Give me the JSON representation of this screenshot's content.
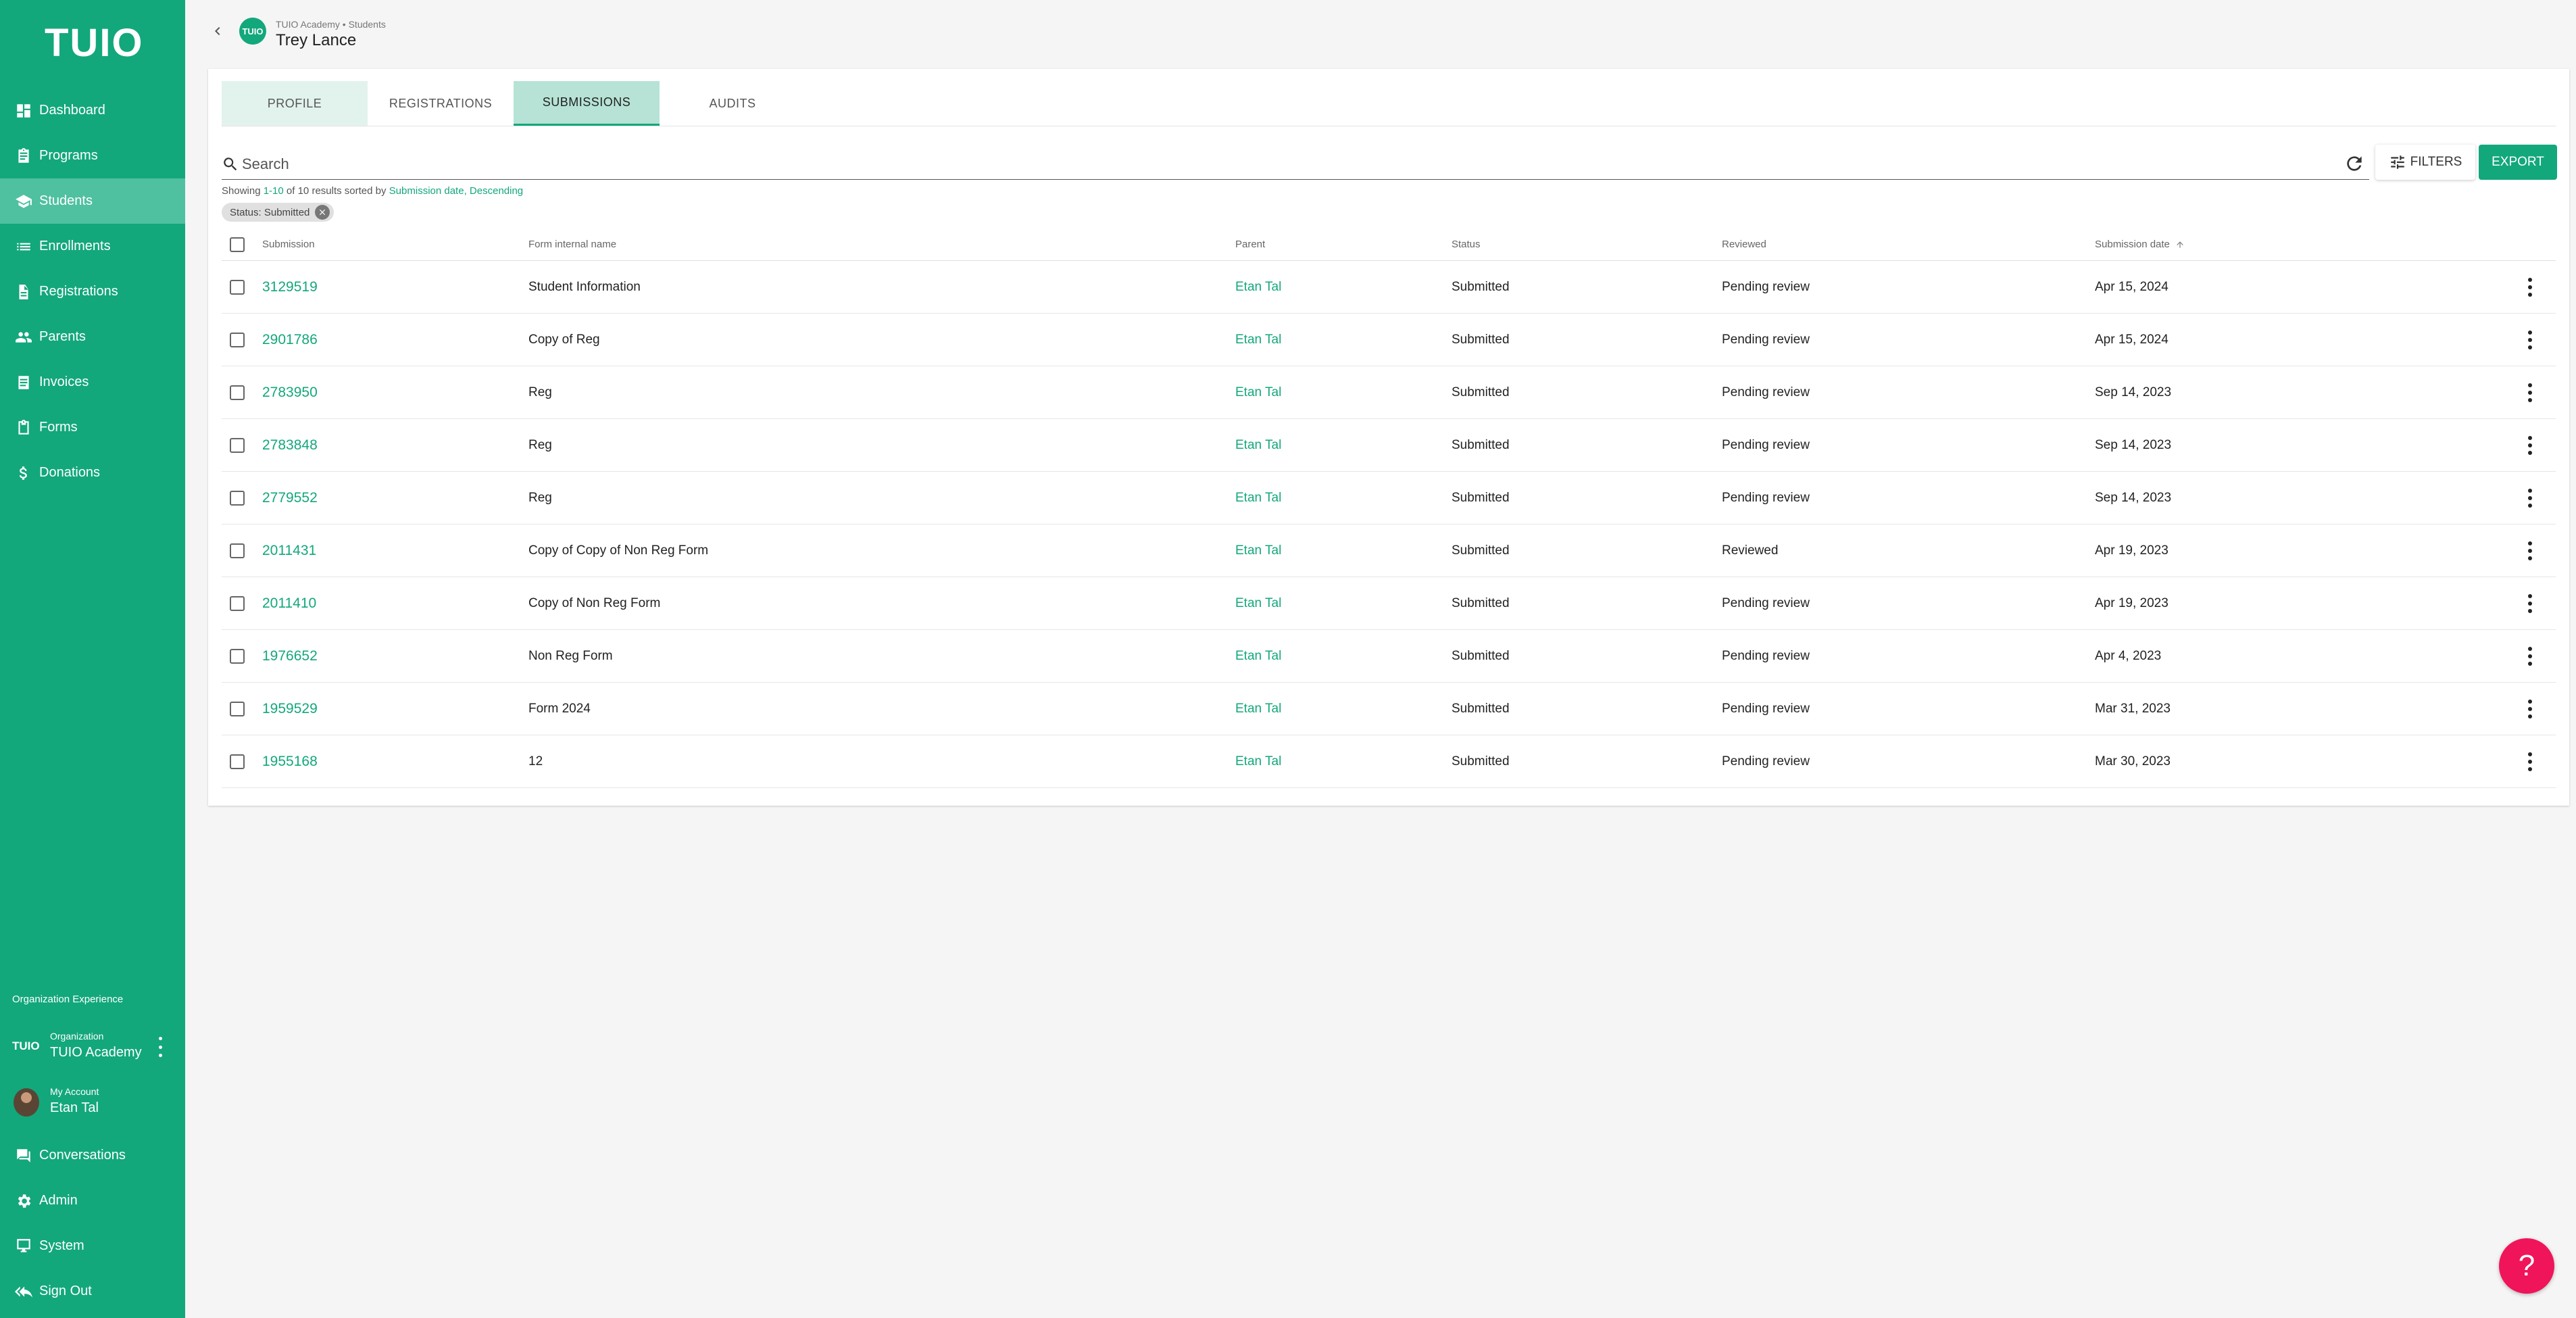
{
  "app": {
    "logo": "TUIO"
  },
  "sidebar": {
    "items": [
      {
        "label": "Dashboard",
        "icon": "dashboard-icon"
      },
      {
        "label": "Programs",
        "icon": "clipboard-icon"
      },
      {
        "label": "Students",
        "icon": "school-icon",
        "active": true
      },
      {
        "label": "Enrollments",
        "icon": "list-icon"
      },
      {
        "label": "Registrations",
        "icon": "document-icon"
      },
      {
        "label": "Parents",
        "icon": "people-icon"
      },
      {
        "label": "Invoices",
        "icon": "receipt-icon"
      },
      {
        "label": "Forms",
        "icon": "form-icon"
      },
      {
        "label": "Donations",
        "icon": "dollar-icon"
      }
    ],
    "org_section_title": "Organization Experience",
    "org": {
      "logo": "TUIO",
      "label": "Organization",
      "name": "TUIO Academy"
    },
    "account": {
      "label": "My Account",
      "name": "Etan Tal"
    },
    "bottom_items": [
      {
        "label": "Conversations",
        "icon": "chat-icon"
      },
      {
        "label": "Admin",
        "icon": "gear-icon"
      },
      {
        "label": "System",
        "icon": "monitor-icon"
      },
      {
        "label": "Sign Out",
        "icon": "sign-out-icon"
      }
    ]
  },
  "header": {
    "avatar_text": "TUIO",
    "breadcrumb": "TUIO Academy • Students",
    "title": "Trey Lance"
  },
  "tabs": [
    {
      "label": "PROFILE"
    },
    {
      "label": "REGISTRATIONS"
    },
    {
      "label": "SUBMISSIONS",
      "active": true
    },
    {
      "label": "AUDITS"
    }
  ],
  "search": {
    "placeholder": "Search"
  },
  "toolbar": {
    "filters_label": "FILTERS",
    "export_label": "EXPORT"
  },
  "results": {
    "prefix": "Showing ",
    "range": "1-10",
    "middle": " of 10 results sorted by ",
    "sort_field": "Submission date",
    "sep": ", ",
    "sort_dir": "Descending"
  },
  "filter_chip": "Status: Submitted",
  "table": {
    "columns": [
      "Submission",
      "Form internal name",
      "Parent",
      "Status",
      "Reviewed",
      "Submission date"
    ],
    "rows": [
      {
        "id": "3129519",
        "form": "Student Information",
        "parent": "Etan Tal",
        "status": "Submitted",
        "reviewed": "Pending review",
        "date": "Apr 15, 2024"
      },
      {
        "id": "2901786",
        "form": "Copy of Reg",
        "parent": "Etan Tal",
        "status": "Submitted",
        "reviewed": "Pending review",
        "date": "Apr 15, 2024"
      },
      {
        "id": "2783950",
        "form": "Reg",
        "parent": "Etan Tal",
        "status": "Submitted",
        "reviewed": "Pending review",
        "date": "Sep 14, 2023"
      },
      {
        "id": "2783848",
        "form": "Reg",
        "parent": "Etan Tal",
        "status": "Submitted",
        "reviewed": "Pending review",
        "date": "Sep 14, 2023"
      },
      {
        "id": "2779552",
        "form": "Reg",
        "parent": "Etan Tal",
        "status": "Submitted",
        "reviewed": "Pending review",
        "date": "Sep 14, 2023"
      },
      {
        "id": "2011431",
        "form": "Copy of Copy of Non Reg Form",
        "parent": "Etan Tal",
        "status": "Submitted",
        "reviewed": "Reviewed",
        "date": "Apr 19, 2023"
      },
      {
        "id": "2011410",
        "form": "Copy of Non Reg Form",
        "parent": "Etan Tal",
        "status": "Submitted",
        "reviewed": "Pending review",
        "date": "Apr 19, 2023"
      },
      {
        "id": "1976652",
        "form": "Non Reg Form",
        "parent": "Etan Tal",
        "status": "Submitted",
        "reviewed": "Pending review",
        "date": "Apr 4, 2023"
      },
      {
        "id": "1959529",
        "form": "Form 2024",
        "parent": "Etan Tal",
        "status": "Submitted",
        "reviewed": "Pending review",
        "date": "Mar 31, 2023"
      },
      {
        "id": "1955168",
        "form": "12",
        "parent": "Etan Tal",
        "status": "Submitted",
        "reviewed": "Pending review",
        "date": "Mar 30, 2023"
      }
    ]
  },
  "help": {
    "label": "?"
  },
  "colors": {
    "brand": "#13a77c",
    "active_nav": "#4fc0a0",
    "help": "#f0145a"
  }
}
